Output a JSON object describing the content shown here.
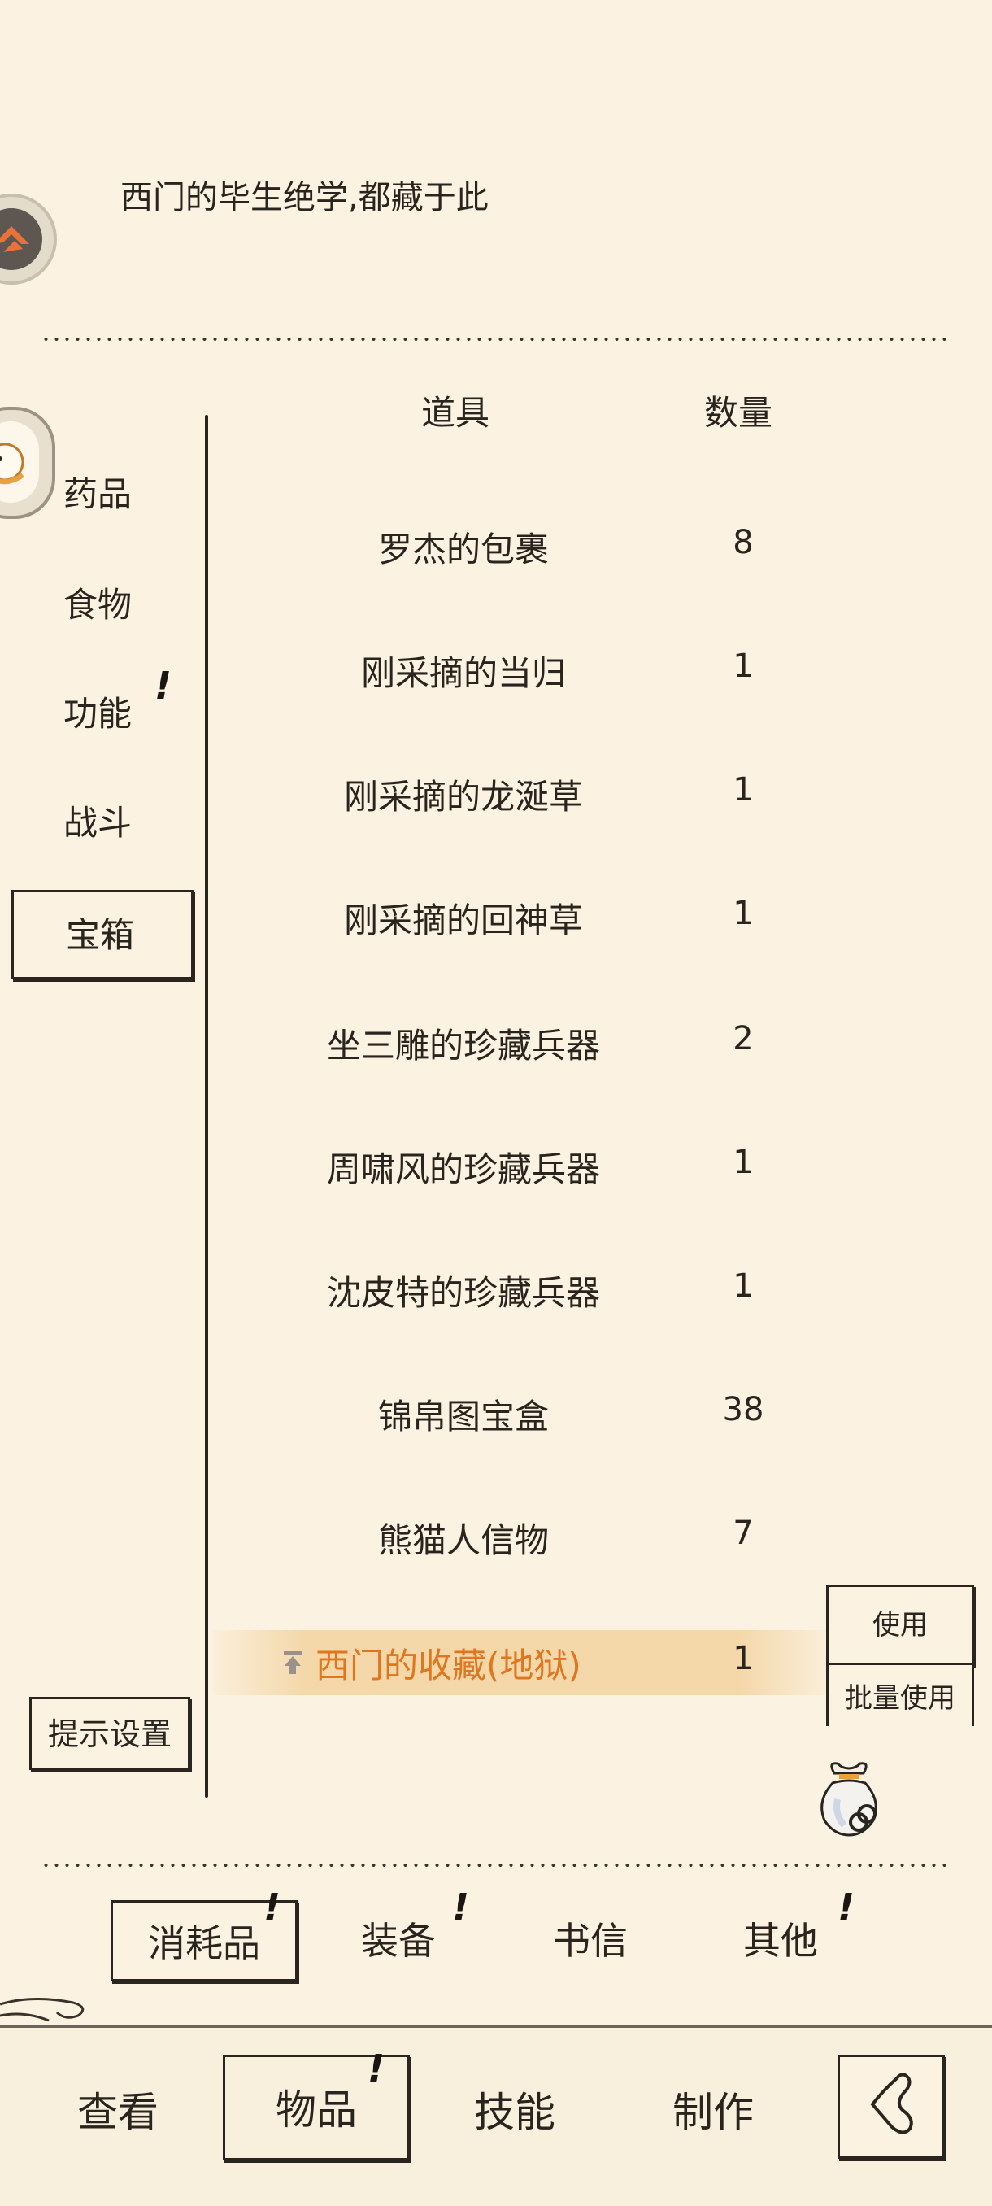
{
  "description": "西门的毕生绝学,都藏于此",
  "categories": [
    {
      "label": "药品",
      "alert": false
    },
    {
      "label": "食物",
      "alert": false
    },
    {
      "label": "功能",
      "alert": true
    },
    {
      "label": "战斗",
      "alert": false
    },
    {
      "label": "宝箱",
      "alert": false,
      "selected": true
    }
  ],
  "table": {
    "headers": {
      "item": "道具",
      "quantity": "数量"
    },
    "rows": [
      {
        "name": "罗杰的包裹",
        "qty": "8"
      },
      {
        "name": "刚采摘的当归",
        "qty": "1"
      },
      {
        "name": "刚采摘的龙涎草",
        "qty": "1"
      },
      {
        "name": "刚采摘的回神草",
        "qty": "1"
      },
      {
        "name": "坐三雕的珍藏兵器",
        "qty": "2"
      },
      {
        "name": "周啸风的珍藏兵器",
        "qty": "1"
      },
      {
        "name": "沈皮特的珍藏兵器",
        "qty": "1"
      },
      {
        "name": "锦帛图宝盒",
        "qty": "38"
      },
      {
        "name": "熊猫人信物",
        "qty": "7"
      },
      {
        "name": "西门的收藏(地狱)",
        "qty": "1",
        "selected": true
      }
    ]
  },
  "actions": {
    "use": "使用",
    "batch_use": "批量使用",
    "hint_settings": "提示设置"
  },
  "bag_tabs": [
    {
      "label": "消耗品",
      "alert": true,
      "selected": true
    },
    {
      "label": "装备",
      "alert": true
    },
    {
      "label": "书信",
      "alert": false
    },
    {
      "label": "其他",
      "alert": true
    }
  ],
  "bottom_nav": [
    {
      "label": "查看"
    },
    {
      "label": "物品",
      "alert": true,
      "selected": true
    },
    {
      "label": "技能"
    },
    {
      "label": "制作"
    }
  ],
  "alert_mark": "!",
  "icons": {
    "back": "back-arrow-icon",
    "bag": "item-bag-icon",
    "pin": "pin-top-icon"
  },
  "colors": {
    "background": "#fbf2e1",
    "highlight_text": "#e0761e",
    "ink": "#2a241f"
  }
}
